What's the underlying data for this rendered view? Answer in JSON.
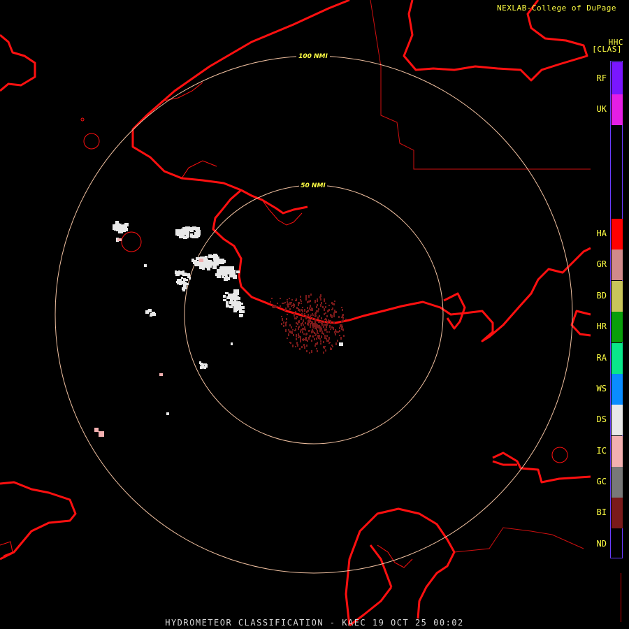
{
  "header": {
    "credit": "NEXLAB-College of DuPage",
    "product_code": "HHC",
    "mode": "[CLAS]"
  },
  "rings": [
    {
      "label": "100 NMI"
    },
    {
      "label": "50 NMI"
    }
  ],
  "legend": [
    {
      "code": "RF",
      "color": "#7a16ff"
    },
    {
      "code": "UK",
      "color": "#e51ee5"
    },
    {
      "code": "",
      "color": "#000000"
    },
    {
      "code": "HA",
      "color": "#ff0000"
    },
    {
      "code": "GR",
      "color": "#d08a8a"
    },
    {
      "code": "BD",
      "color": "#c8c45a"
    },
    {
      "code": "HR",
      "color": "#0a9e0a"
    },
    {
      "code": "RA",
      "color": "#0ae68a"
    },
    {
      "code": "WS",
      "color": "#0a8cff"
    },
    {
      "code": "DS",
      "color": "#e8e8e8"
    },
    {
      "code": "IC",
      "color": "#f2b0b0"
    },
    {
      "code": "GC",
      "color": "#787878"
    },
    {
      "code": "BI",
      "color": "#7a1a1a"
    },
    {
      "code": "ND",
      "color": "#000000"
    }
  ],
  "colors": {
    "coastline": "#ff1010",
    "boundary": "#d01010",
    "range_ring": "#f0c0a0",
    "ring_label": "#ffff44",
    "text": "#ffff44",
    "legend_border": "#6a3cff"
  },
  "footer": "HYDROMETEOR CLASSIFICATION - KAEC 19 OCT 25 00:02"
}
